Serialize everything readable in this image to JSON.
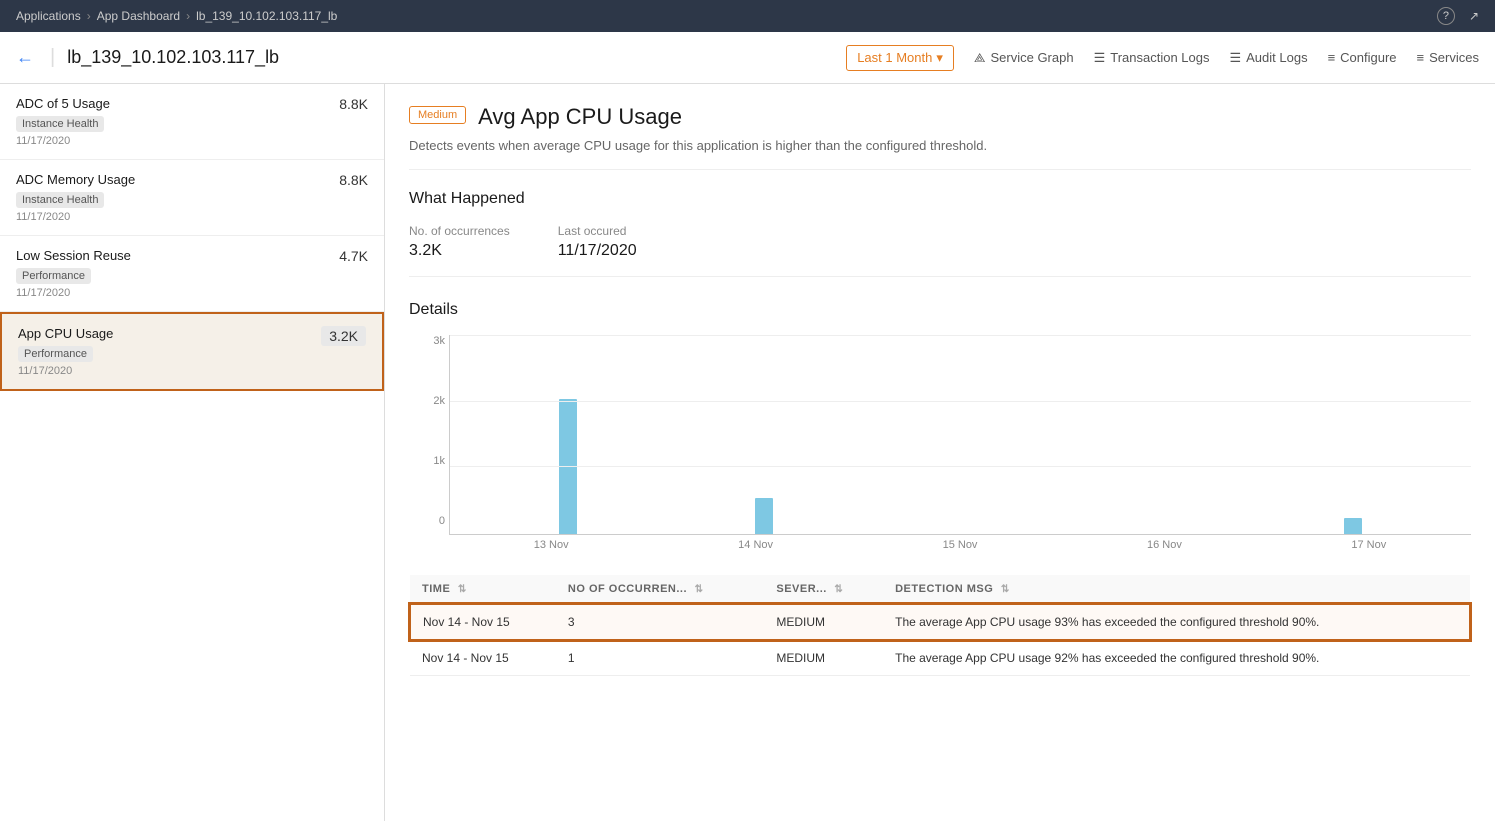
{
  "breadcrumb": {
    "items": [
      "Applications",
      "App Dashboard",
      "lb_139_10.102.103.117_lb"
    ]
  },
  "header": {
    "back_icon": "←",
    "title": "lb_139_10.102.103.117_lb",
    "time_selector": "Last 1 Month",
    "time_icon": "▾",
    "nav_items": [
      {
        "id": "service-graph",
        "icon": "⟁",
        "label": "Service Graph"
      },
      {
        "id": "transaction-logs",
        "icon": "☰",
        "label": "Transaction Logs"
      },
      {
        "id": "audit-logs",
        "icon": "☰",
        "label": "Audit Logs"
      },
      {
        "id": "configure",
        "icon": "≡",
        "label": "Configure"
      },
      {
        "id": "services",
        "icon": "≡",
        "label": "Services"
      }
    ],
    "help_icon": "?",
    "external_icon": "↗"
  },
  "sidebar": {
    "items": [
      {
        "id": "adc-cpu-usage",
        "name": "ADC of 5 Usage",
        "badge": "Instance Health",
        "date": "11/17/2020",
        "count": "8.8K",
        "selected": false
      },
      {
        "id": "adc-memory-usage",
        "name": "ADC Memory Usage",
        "badge": "Instance Health",
        "date": "11/17/2020",
        "count": "8.8K",
        "selected": false
      },
      {
        "id": "low-session-reuse",
        "name": "Low Session Reuse",
        "badge": "Performance",
        "date": "11/17/2020",
        "count": "4.7K",
        "selected": false
      },
      {
        "id": "app-cpu-usage",
        "name": "App CPU Usage",
        "badge": "Performance",
        "date": "11/17/2020",
        "count": "3.2K",
        "selected": true
      }
    ]
  },
  "detail": {
    "severity": "Medium",
    "title": "Avg App CPU Usage",
    "description": "Detects events when average CPU usage for this application is higher than the configured threshold.",
    "what_happened": {
      "title": "What Happened",
      "occurrences_label": "No. of occurrences",
      "occurrences_value": "3.2K",
      "last_occurred_label": "Last occured",
      "last_occurred_value": "11/17/2020"
    },
    "details_title": "Details",
    "chart": {
      "y_labels": [
        "3k",
        "2k",
        "1k",
        "0"
      ],
      "x_labels": [
        "13 Nov",
        "14 Nov",
        "15 Nov",
        "16 Nov",
        "17 Nov"
      ],
      "bars": [
        {
          "date": "13 Nov",
          "height_pct": 68
        },
        {
          "date": "14 Nov",
          "height_pct": 18
        },
        {
          "date": "15 Nov",
          "height_pct": 0
        },
        {
          "date": "16 Nov",
          "height_pct": 0
        },
        {
          "date": "17 Nov",
          "height_pct": 8
        }
      ]
    },
    "table": {
      "columns": [
        {
          "id": "time",
          "label": "TIME"
        },
        {
          "id": "occurrences",
          "label": "NO OF OCCURREN..."
        },
        {
          "id": "severity",
          "label": "SEVER..."
        },
        {
          "id": "detection_msg",
          "label": "DETECTION MSG"
        }
      ],
      "rows": [
        {
          "time": "Nov 14 - Nov 15",
          "occurrences": "3",
          "severity": "MEDIUM",
          "detection_msg": "The average App CPU usage 93% has exceeded the configured threshold 90%.",
          "highlighted": true
        },
        {
          "time": "Nov 14 - Nov 15",
          "occurrences": "1",
          "severity": "MEDIUM",
          "detection_msg": "The average App CPU usage 92% has exceeded the configured threshold 90%.",
          "highlighted": false
        }
      ]
    }
  }
}
